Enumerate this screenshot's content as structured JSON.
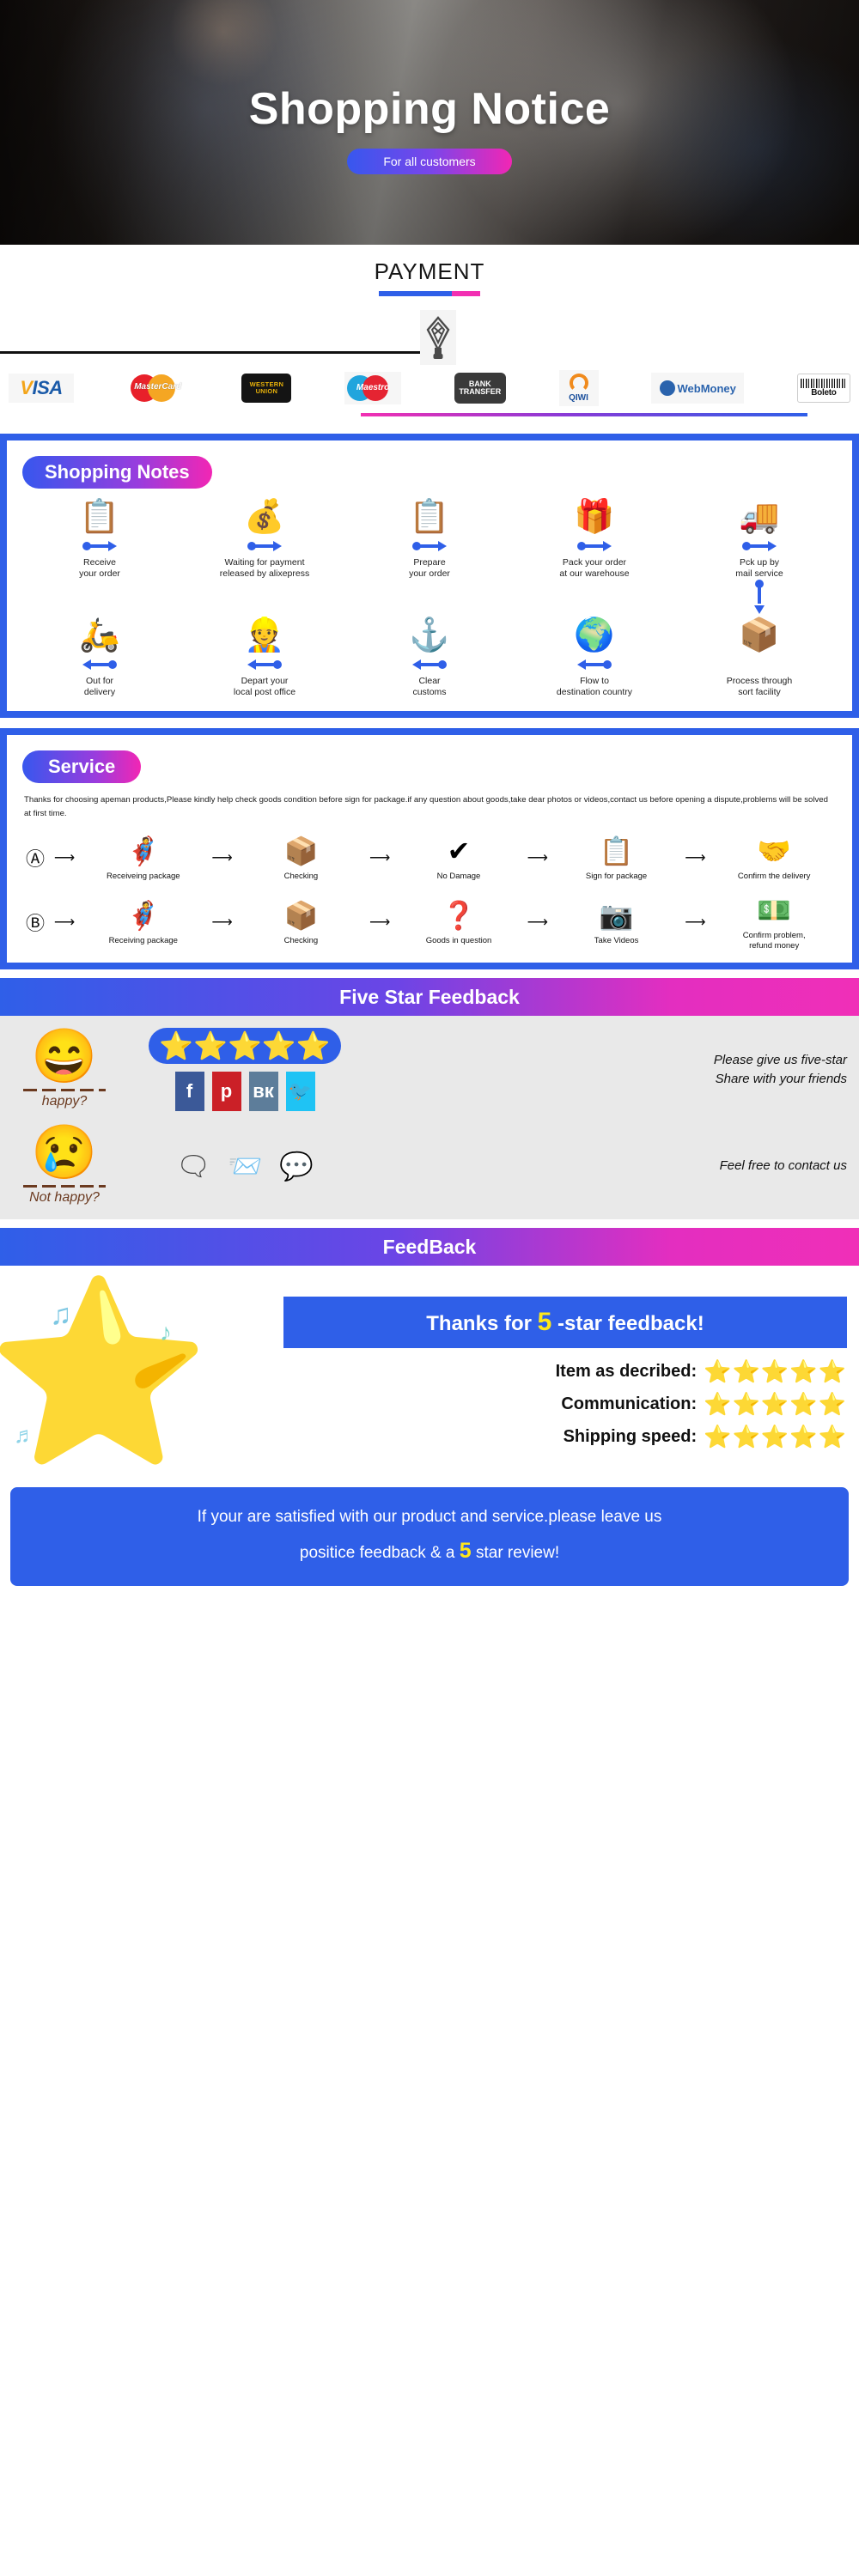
{
  "hero": {
    "title": "Shopping Notice",
    "pill_label": "For all customers"
  },
  "payment": {
    "title": "PAYMENT",
    "logos": [
      {
        "name": "visa",
        "label": "VISA"
      },
      {
        "name": "mastercard",
        "label": "MasterCard"
      },
      {
        "name": "western-union",
        "label": "WESTERN UNION"
      },
      {
        "name": "maestro",
        "label": "Maestro"
      },
      {
        "name": "bank-transfer",
        "label": "BANK TRANSFER"
      },
      {
        "name": "qiwi",
        "label": "QIWI"
      },
      {
        "name": "webmoney",
        "label": "WebMoney"
      },
      {
        "name": "boleto",
        "label": "Boleto"
      }
    ]
  },
  "shopping_notes": {
    "title": "Shopping Notes",
    "row1": [
      {
        "icon": "clipboard",
        "glyph": "📋",
        "label": "Receive\nyour order",
        "arrow": "right"
      },
      {
        "icon": "money-bag",
        "glyph": "💰",
        "label": "Waiting for payment\nreleased by alixepress",
        "arrow": "right"
      },
      {
        "icon": "clipboard",
        "glyph": "📋",
        "label": "Prepare\nyour order",
        "arrow": "right"
      },
      {
        "icon": "gift-box",
        "glyph": "🎁",
        "label": "Pack your order\nat our warehouse",
        "arrow": "right"
      },
      {
        "icon": "delivery-truck",
        "glyph": "🚚",
        "label": "Pck up by\nmail service",
        "arrow": "right"
      }
    ],
    "row2": [
      {
        "icon": "scooter",
        "glyph": "🛵",
        "label": "Out for\ndelivery",
        "arrow": "left"
      },
      {
        "icon": "postal-worker",
        "glyph": "👷",
        "label": "Depart your\nlocal post office",
        "arrow": "left"
      },
      {
        "icon": "anchor",
        "glyph": "⚓",
        "label": "Clear\ncustoms",
        "arrow": "left"
      },
      {
        "icon": "globe",
        "glyph": "🌍",
        "label": "Flow to\ndestination country",
        "arrow": "left"
      },
      {
        "icon": "package-cart",
        "glyph": "📦",
        "label": "Process through\nsort facility",
        "arrow": "down"
      }
    ]
  },
  "service": {
    "title": "Service",
    "paragraph": "Thanks for choosing apeman products,Please kindly help check goods condition before sign for package.if any question about goods,take dear photos or videos,contact us before opening a dispute,problems will be solved at first time.",
    "flow_a_tag": "Ⓐ",
    "flow_b_tag": "Ⓑ",
    "arrow": "⟶",
    "flow_a": [
      {
        "icon": "person-holding-package",
        "glyph": "🦸",
        "label": "Receiveing package"
      },
      {
        "icon": "person-opening-box",
        "glyph": "📦",
        "label": "Checking"
      },
      {
        "icon": "check-mark",
        "glyph": "✔",
        "label": "No Damage"
      },
      {
        "icon": "signed-document",
        "glyph": "📋",
        "label": "Sign for package"
      },
      {
        "icon": "handshake",
        "glyph": "🤝",
        "label": "Confirm the delivery"
      }
    ],
    "flow_b": [
      {
        "icon": "person-holding-package",
        "glyph": "🦸",
        "label": "Receiving package"
      },
      {
        "icon": "person-opening-box",
        "glyph": "📦",
        "label": "Checking"
      },
      {
        "icon": "question-box",
        "glyph": "❓",
        "label": "Goods in question"
      },
      {
        "icon": "camera",
        "glyph": "📷",
        "label": "Take Videos"
      },
      {
        "icon": "refund-agent",
        "glyph": "💵",
        "label": "Confirm problem,\nrefund money"
      }
    ]
  },
  "five_star": {
    "banner": "Five Star Feedback",
    "happy": {
      "face_icon": "smiling-face",
      "face_glyph": "😄",
      "label": "happy?",
      "stars": "⭐⭐⭐⭐⭐",
      "message_line1": "Please give us five-star",
      "message_line2": "Share with your friends",
      "socials": [
        {
          "name": "facebook",
          "glyph": "f"
        },
        {
          "name": "pinterest",
          "glyph": "р"
        },
        {
          "name": "vk",
          "glyph": "вк"
        },
        {
          "name": "twitter",
          "glyph": "🐦"
        }
      ]
    },
    "unhappy": {
      "face_icon": "crying-face",
      "face_glyph": "😢",
      "label": "Not happy?",
      "contact_icons": [
        {
          "name": "skype-icon",
          "glyph": "🗨"
        },
        {
          "name": "email-icon",
          "glyph": "📨"
        },
        {
          "name": "wechat-icon",
          "glyph": "💬"
        }
      ],
      "message": "Feel free to contact us"
    }
  },
  "feedback": {
    "banner": "FeedBack",
    "thanks_prefix": "Thanks for",
    "thanks_number": "5",
    "thanks_suffix": "-star feedback!",
    "star_icon": "star-face",
    "star_glyph": "⭐",
    "music_notes": [
      "♫",
      "♪",
      "♬"
    ],
    "ratings": [
      {
        "label": "Item as decribed:",
        "stars": "⭐⭐⭐⭐⭐",
        "value": 5
      },
      {
        "label": "Communication:",
        "stars": "⭐⭐⭐⭐⭐",
        "value": 5
      },
      {
        "label": "Shipping speed:",
        "stars": "⭐⭐⭐⭐⭐",
        "value": 5
      }
    ],
    "cta_line1": "If your are satisfied with our product and service.please leave us",
    "cta_line2_pre": "positice feedback & a",
    "cta_number": "5",
    "cta_line2_post": "star review!"
  },
  "colors": {
    "brand_blue": "#2f5fe8",
    "brand_magenta": "#f02fb8",
    "star_yellow": "#ffe81a",
    "gray_bg": "#e9e9e9"
  }
}
